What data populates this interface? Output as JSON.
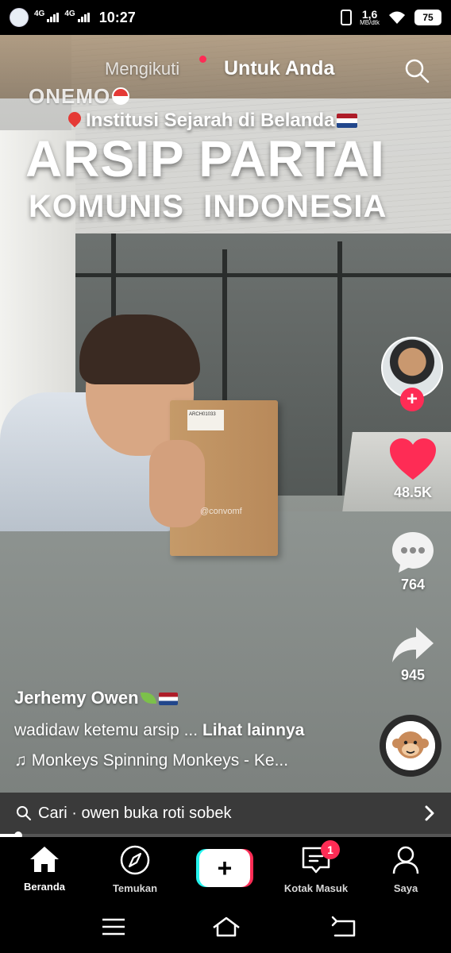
{
  "status_bar": {
    "network_1": "4G",
    "network_2": "4G",
    "time": "10:27",
    "speed_value": "1,6",
    "speed_unit": "MB/dtk",
    "battery": "75"
  },
  "top_nav": {
    "following_label": "Mengikuti",
    "for_you_label": "Untuk Anda",
    "search_icon": "search-icon"
  },
  "overlay": {
    "brand": "ONEMO",
    "subtitle": "Institusi Sejarah di Belanda",
    "title_line1": "ARSIP PARTAI",
    "title_line2": "KOMUNIS  INDONESIA",
    "box_label": "ARCH01033",
    "watermark": "@convomf"
  },
  "actions": {
    "like_count": "48.5K",
    "comment_count": "764",
    "share_count": "945"
  },
  "caption": {
    "author": "Jerhemy Owen",
    "description": "wadidaw ketemu arsip ...",
    "more_label": "Lihat lainnya",
    "sound": "Monkeys Spinning Monkeys - Ke..."
  },
  "search_suggestion": {
    "text": "Cari · owen buka roti sobek"
  },
  "video_progress": 0.04,
  "tab_bar": {
    "home_label": "Beranda",
    "discover_label": "Temukan",
    "create_label": "+",
    "inbox_label": "Kotak Masuk",
    "inbox_badge": "1",
    "profile_label": "Saya"
  },
  "colors": {
    "accent_red": "#fe2c55",
    "accent_cyan": "#25f4ee",
    "like_heart": "#fe2c55"
  }
}
